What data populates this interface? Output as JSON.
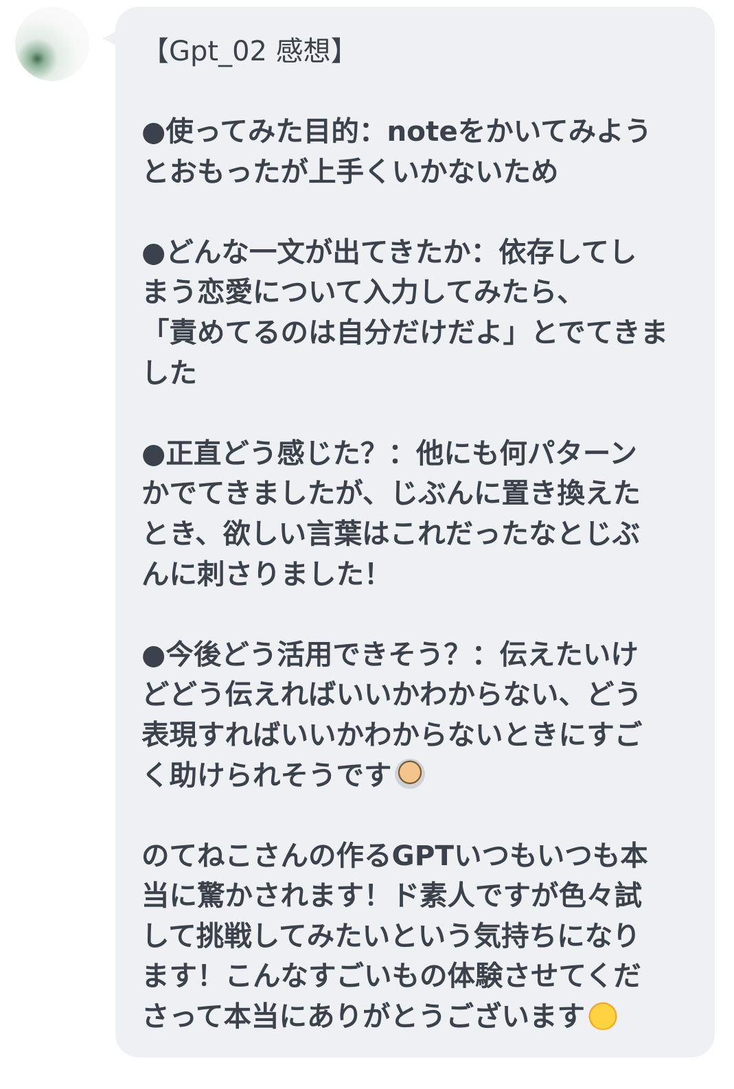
{
  "message": {
    "title": "【Gpt_02 感想】",
    "section1": {
      "lines": [
        "●使ってみた目的：noteをかいてみよう",
        "とおもったが上手くいかないため"
      ]
    },
    "section2": {
      "lines": [
        "●どんな一文が出てきたか：依存してし",
        "まう恋愛について入力してみたら、",
        "「責めてるのは自分だけだよ」とでてきま",
        "した"
      ]
    },
    "section3": {
      "lines": [
        "●正直どう感じた？：他にも何パターン",
        "かでてきましたが、じぶんに置き換えた",
        "とき、欲しい言葉はこれだったなとじぶ",
        "んに刺さりました！"
      ]
    },
    "section4": {
      "lines": [
        "●今後どう活用できそう？：伝えたいけ",
        "どどう伝えればいいかわからない、どう",
        "表現すればいいかわからないときにすご",
        "く助けられそうです"
      ],
      "emoji": "person-gesturing-ok-emoji"
    },
    "section5": {
      "lines": [
        "のてねこさんの作るGPTいつもいつも本",
        "当に驚かされます！ド素人ですが色々試",
        "して挑戦してみたいという気持ちになり",
        "ます！こんなすごいもの体験させてくだ",
        "さって本当にありがとうございます"
      ],
      "emoji": "pleading-face-emoji"
    }
  },
  "colors": {
    "bubble": "#eef0f3",
    "text": "#3c424b"
  }
}
